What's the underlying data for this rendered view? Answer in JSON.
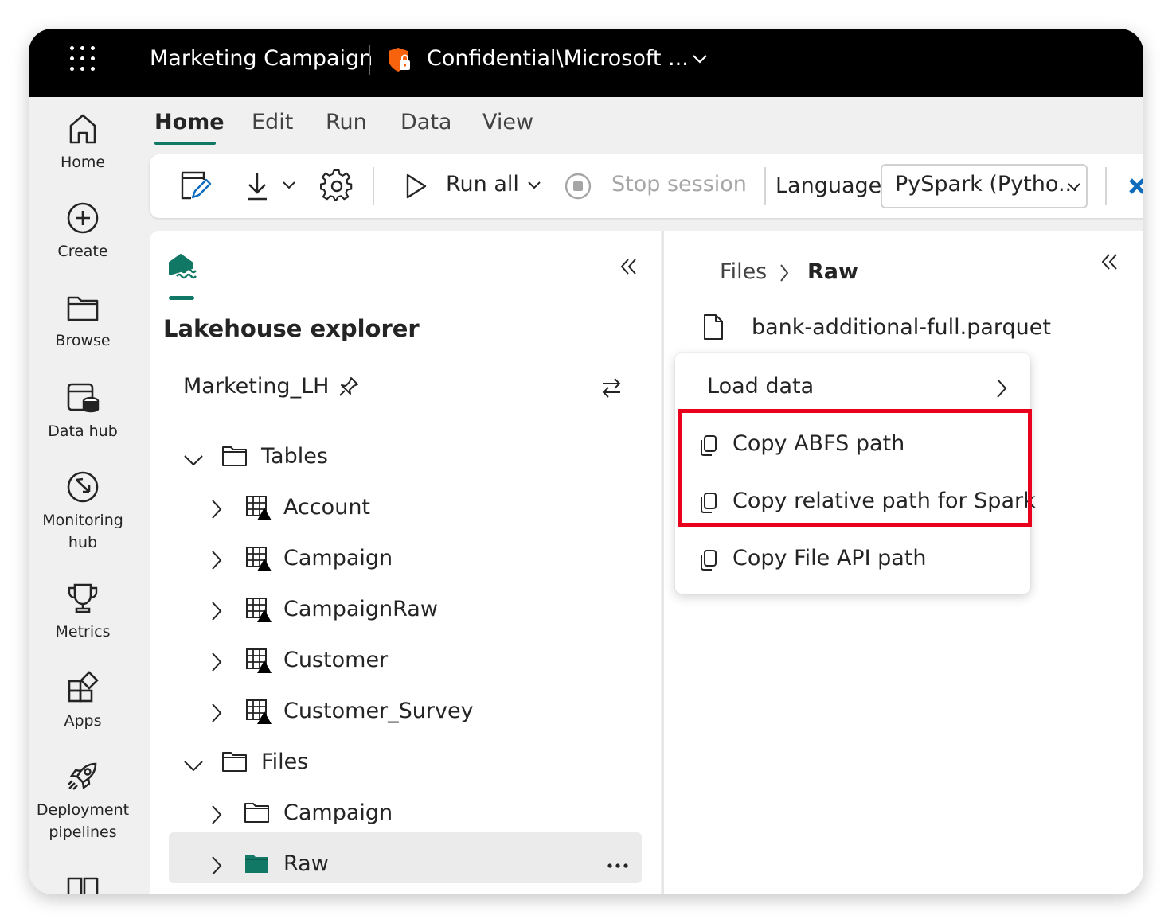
{
  "topbar": {
    "app_title": "Marketing Campaign",
    "sensitivity_label": "Confidential\\Microsoft ...",
    "icons": [
      "app-launcher-icon",
      "sensitivity-shield-icon",
      "chevron-down-icon"
    ]
  },
  "nav": {
    "home": "Home",
    "create": "Create",
    "browse": "Browse",
    "data_hub": "Data hub",
    "monitoring_1": "Monitoring",
    "monitoring_2": "hub",
    "metrics": "Metrics",
    "apps": "Apps",
    "deployment_1": "Deployment",
    "deployment_2": "pipelines"
  },
  "tabs": {
    "home": "Home",
    "edit": "Edit",
    "run": "Run",
    "data": "Data",
    "view": "View"
  },
  "toolbar": {
    "run_all": "Run all",
    "stop_session": "Stop session",
    "language_label": "Language",
    "language_value": "PySpark (Pytho..."
  },
  "explorer": {
    "title": "Lakehouse explorer",
    "lakehouse_name": "Marketing_LH",
    "tables_label": "Tables",
    "tables": [
      "Account",
      "Campaign",
      "CampaignRaw",
      "Customer",
      "Customer_Survey"
    ],
    "files_label": "Files",
    "files": [
      "Campaign",
      "Raw"
    ]
  },
  "files_pane": {
    "breadcrumb_root": "Files",
    "breadcrumb_current": "Raw",
    "file_name": "bank-additional-full.parquet"
  },
  "context_menu": {
    "load_data": "Load data",
    "copy_abfs": "Copy ABFS path",
    "copy_relative": "Copy relative path for Spark",
    "copy_file_api": "Copy File API path"
  },
  "colors": {
    "accent": "#117865",
    "highlight": "#e8001c",
    "topbar": "#000000"
  }
}
